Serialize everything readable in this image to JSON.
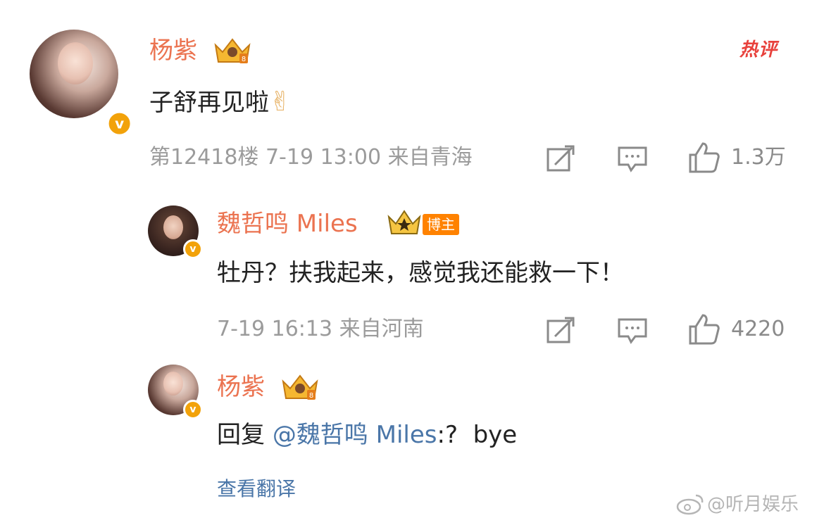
{
  "hot_label": "热评",
  "comment": {
    "username": "杨紫",
    "text": "子舒再见啦",
    "emoji": "✌",
    "meta": "第12418楼 7-19 13:00 来自青海",
    "likes": "1.3万"
  },
  "reply1": {
    "username": "魏哲鸣 Miles",
    "host_badge": "博主",
    "text": "牡丹？扶我起来，感觉我还能救一下！",
    "meta": "7-19 16:13 来自河南",
    "likes": "4220"
  },
  "reply2": {
    "username": "杨紫",
    "reply_prefix": "回复",
    "mention": "@魏哲鸣 Miles",
    "text": ":?  bye",
    "translate": "查看翻译"
  },
  "watermark": "@听月娱乐",
  "colors": {
    "name": "#eb7350",
    "link": "#4a76a8",
    "meta": "#9b9b9b",
    "hot": "#e8413c",
    "vip": "#f2a20a"
  }
}
